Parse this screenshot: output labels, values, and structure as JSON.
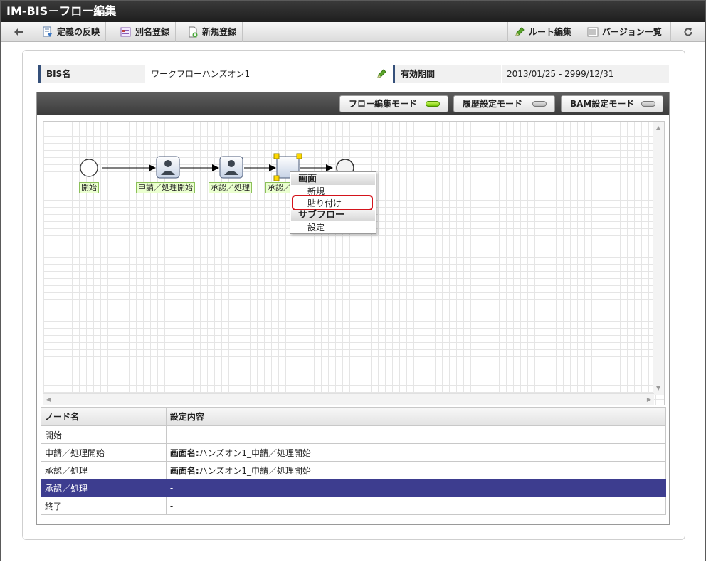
{
  "app": {
    "title_prefix": "IM-BIS",
    "title_sep": "－",
    "title": "フロー編集"
  },
  "toolbar": {
    "apply_label": "定義の反映",
    "alias_label": "別名登録",
    "new_label": "新規登録",
    "route_edit_label": "ルート編集",
    "version_list_label": "バージョン一覧"
  },
  "info": {
    "bis_name_label": "BIS名",
    "bis_name_value": "ワークフローハンズオン1",
    "period_label": "有効期間",
    "period_start": "2013/01/25",
    "period_sep": "-",
    "period_end": "2999/12/31"
  },
  "modes": {
    "flow_edit": "フロー編集モード",
    "history_setting": "履歴設定モード",
    "bam_setting": "BAM設定モード"
  },
  "nodes": {
    "start": "開始",
    "apply_start": "申請／処理開始",
    "approve1": "承認／処理",
    "approve2_partial": "承認／"
  },
  "context_menu": {
    "section_screen": "画面",
    "new": "新規",
    "paste": "貼り付け",
    "section_subflow": "サブフロー",
    "setting": "設定"
  },
  "table": {
    "col_node": "ノード名",
    "col_setting": "設定内容",
    "rows": [
      {
        "node": "開始",
        "setting_label": "",
        "setting_value": "-"
      },
      {
        "node": "申請／処理開始",
        "setting_label": "画面名:",
        "setting_value": "ハンズオン1_申請／処理開始"
      },
      {
        "node": "承認／処理",
        "setting_label": "画面名:",
        "setting_value": "ハンズオン1_申請／処理開始"
      },
      {
        "node": "承認／処理",
        "setting_label": "",
        "setting_value": "-"
      },
      {
        "node": "終了",
        "setting_label": "",
        "setting_value": "-"
      }
    ]
  },
  "colors": {
    "title_bar": "#2a2a2a",
    "selected_row": "#3d3d8f",
    "highlight": "#d3141c",
    "led_on": "#6fc400",
    "node_label_bg": "#eaffcf"
  }
}
